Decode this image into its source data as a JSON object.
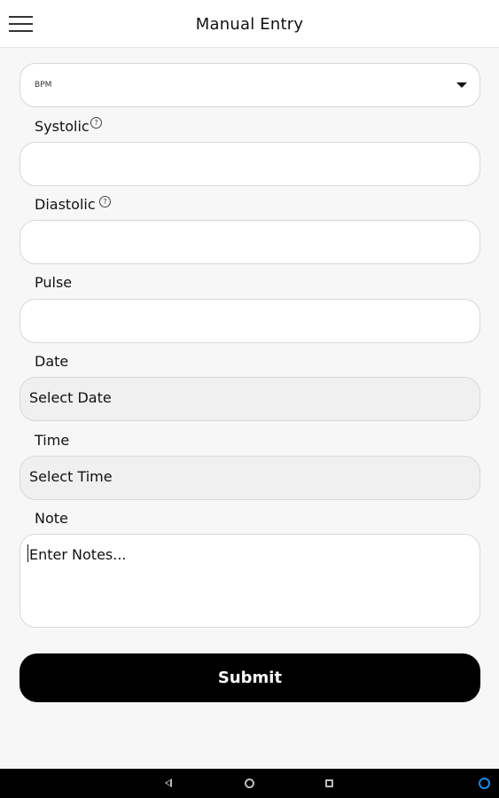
{
  "app_bar": {
    "title": "Manual Entry",
    "menu_icon": "hamburger-menu-icon"
  },
  "form": {
    "unit_select": {
      "value": "BPM",
      "icon": "dropdown-caret-icon"
    },
    "systolic": {
      "label": "Systolic",
      "help_icon": "question-circle-icon",
      "value": ""
    },
    "diastolic": {
      "label": "Diastolic",
      "help_icon": "question-circle-icon",
      "value": ""
    },
    "pulse": {
      "label": "Pulse",
      "value": ""
    },
    "date": {
      "label": "Date",
      "placeholder": "Select Date"
    },
    "time": {
      "label": "Time",
      "placeholder": "Select Time"
    },
    "note": {
      "label": "Note",
      "placeholder": "Enter Notes..."
    },
    "submit_label": "Submit"
  },
  "system_nav": {
    "back_icon": "back-triangle-icon",
    "home_icon": "home-circle-icon",
    "recents_icon": "recents-square-icon",
    "assistant_icon": "assistant-circle-icon"
  },
  "colors": {
    "background": "#f7f7f7",
    "field_bg": "#ffffff",
    "picker_bg": "#f0f0f0",
    "button_bg": "#000000",
    "assistant_accent": "#1e88e5"
  }
}
